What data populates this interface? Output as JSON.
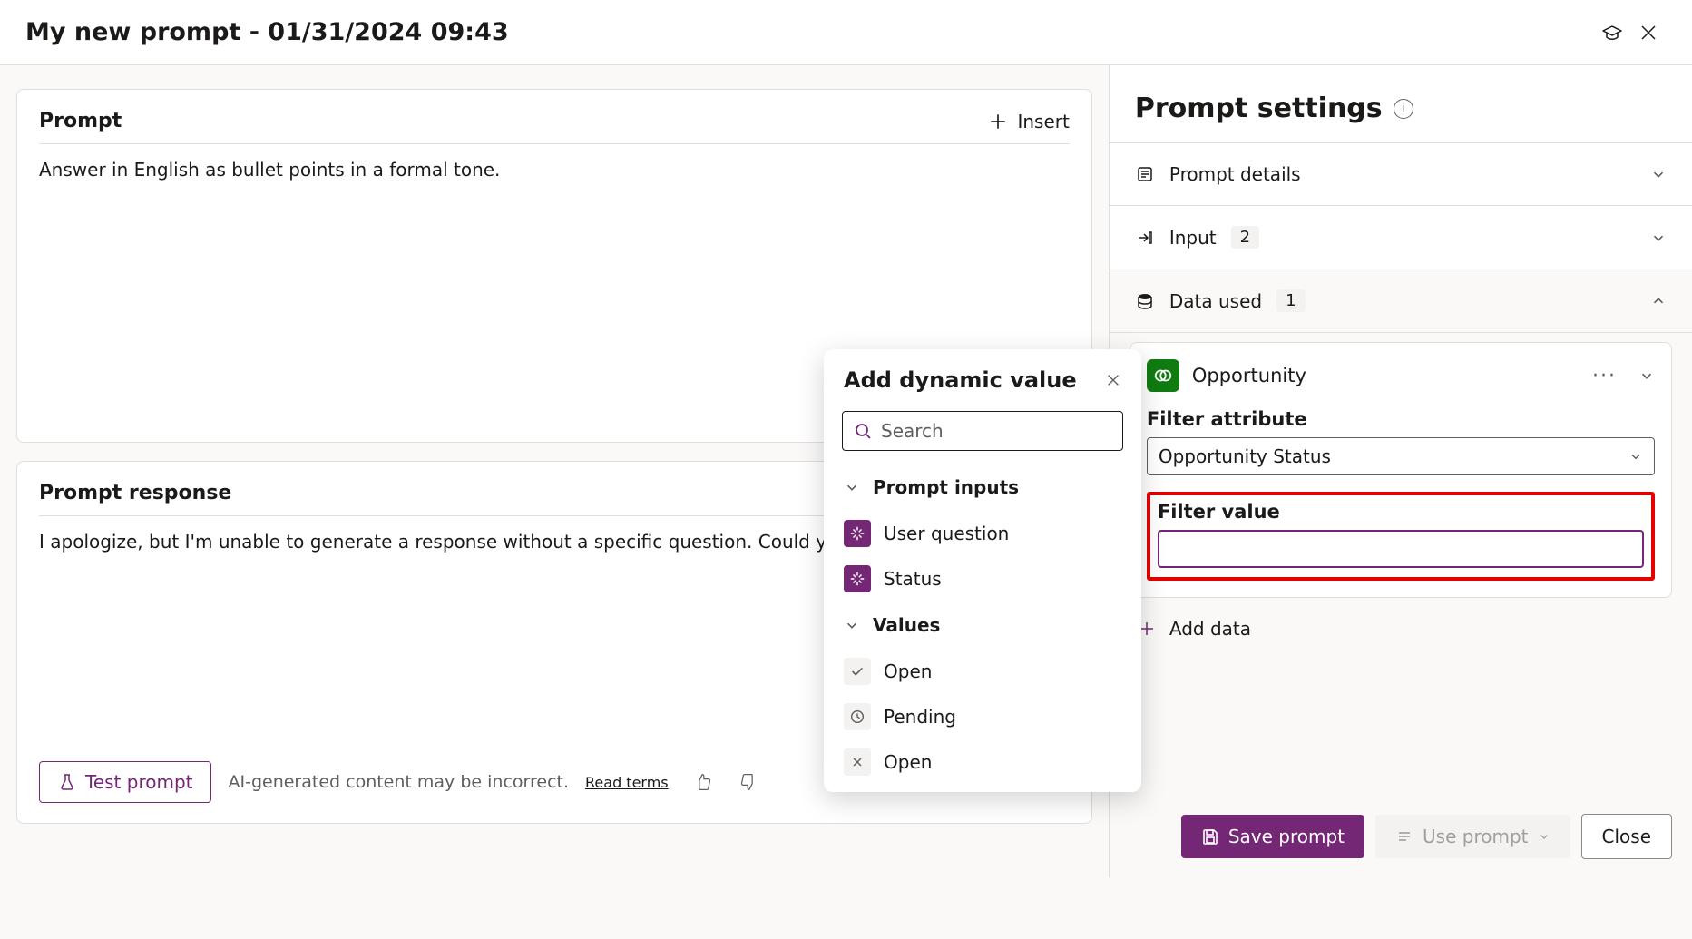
{
  "header": {
    "title": "My new prompt - 01/31/2024 09:43"
  },
  "prompt_card": {
    "title": "Prompt",
    "insert_label": "Insert",
    "content": "Answer in English as bullet points in a formal tone."
  },
  "response_card": {
    "title": "Prompt response",
    "content": "I apologize, but I'm unable to generate a response without a specific question. Could you please provide more de",
    "test_label": "Test prompt",
    "ai_note": "AI-generated content may be incorrect.",
    "read_terms": "Read terms"
  },
  "settings": {
    "title": "Prompt settings",
    "details_label": "Prompt details",
    "input_label": "Input",
    "input_count": "2",
    "data_used_label": "Data used",
    "data_used_count": "1",
    "opportunity": {
      "name": "Opportunity",
      "filter_attr_label": "Filter attribute",
      "filter_attr_value": "Opportunity Status",
      "filter_value_label": "Filter value",
      "filter_value": ""
    },
    "add_data_label": "Add data"
  },
  "popup": {
    "title": "Add dynamic value",
    "search_placeholder": "Search",
    "group_inputs": "Prompt inputs",
    "item_user_question": "User question",
    "item_status": "Status",
    "group_values": "Values",
    "item_open1": "Open",
    "item_pending": "Pending",
    "item_open2": "Open"
  },
  "footer": {
    "save": "Save prompt",
    "use": "Use prompt",
    "close": "Close"
  }
}
